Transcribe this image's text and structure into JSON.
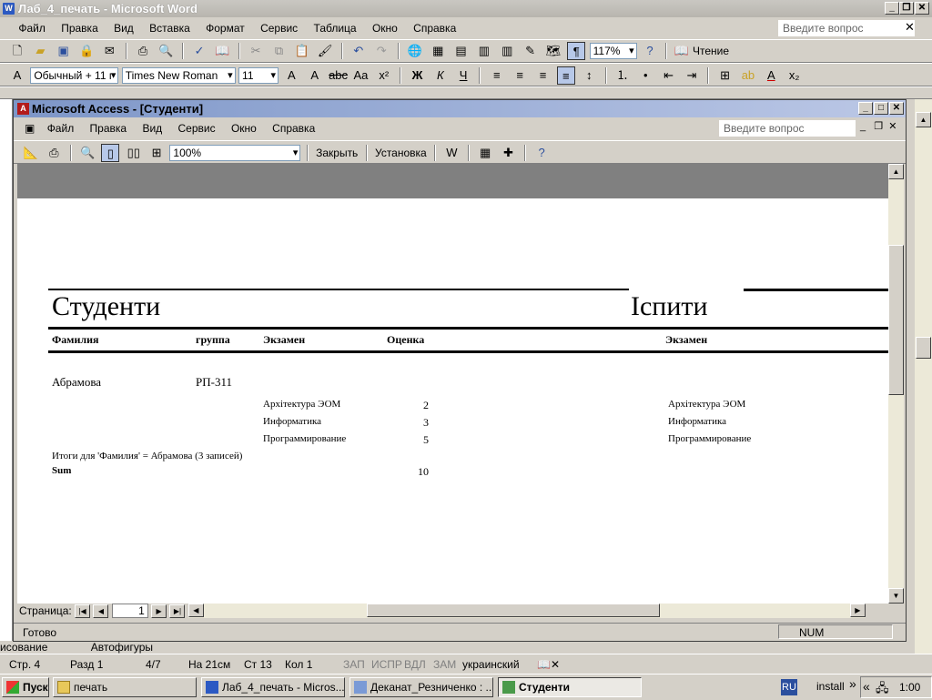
{
  "word": {
    "title": "Лаб_4_печать - Microsoft Word",
    "menu": [
      "Файл",
      "Правка",
      "Вид",
      "Вставка",
      "Формат",
      "Сервис",
      "Таблица",
      "Окно",
      "Справка"
    ],
    "ask_placeholder": "Введите вопрос",
    "zoom": "117%",
    "reading_label": "Чтение",
    "style": "Обычный + 11 г",
    "font": "Times New Roman",
    "size": "11",
    "bold_label": "Ж",
    "italic_label": "К",
    "underline_label": "Ч",
    "status": {
      "page": "Стр. 4",
      "section": "Разд 1",
      "pages": "4/7",
      "at": "На 21см",
      "line": "Ст 13",
      "col": "Кол 1",
      "rec": "ЗАП",
      "trk": "ИСПР",
      "ext": "ВДЛ",
      "ovr": "ЗАМ",
      "lang": "украинский"
    },
    "behind_text": {
      "draw": "исование",
      "autoshapes": "Автофигуры"
    }
  },
  "access": {
    "title": "Microsoft Access - [Студенти]",
    "menu": [
      "Файл",
      "Правка",
      "Вид",
      "Сервис",
      "Окно",
      "Справка"
    ],
    "ask_placeholder": "Введите вопрос",
    "zoom": "100%",
    "close_label": "Закрыть",
    "setup_label": "Установка",
    "page_label": "Страница:",
    "page_value": "1",
    "status_ready": "Готово",
    "status_num": "NUM"
  },
  "report": {
    "title": "Студенти",
    "title2": "Іспити",
    "headers": {
      "surname": "Фамилия",
      "group": "группа",
      "exam": "Экзамен",
      "grade": "Оценка",
      "exam2": "Экзамен"
    },
    "student": {
      "surname": "Абрамова",
      "group": "РП-311"
    },
    "exams": [
      {
        "name": "Архітектура ЭОМ",
        "grade": "2"
      },
      {
        "name": "Информатика",
        "grade": "3"
      },
      {
        "name": "Программирование",
        "grade": "5"
      }
    ],
    "exams2": [
      "Архітектура ЭОМ",
      "Информатика",
      "Программирование"
    ],
    "summary": "Итоги для 'Фамилия' =  Абрамова (3 записей)",
    "sum_label": "Sum",
    "sum_value": "10"
  },
  "taskbar": {
    "start": "Пуск",
    "buttons": [
      "печать",
      "Лаб_4_печать - Micros...",
      "Деканат_Резниченко : ...",
      "Студенти"
    ],
    "lang": "RU",
    "install": "install",
    "clock": "1:00"
  }
}
